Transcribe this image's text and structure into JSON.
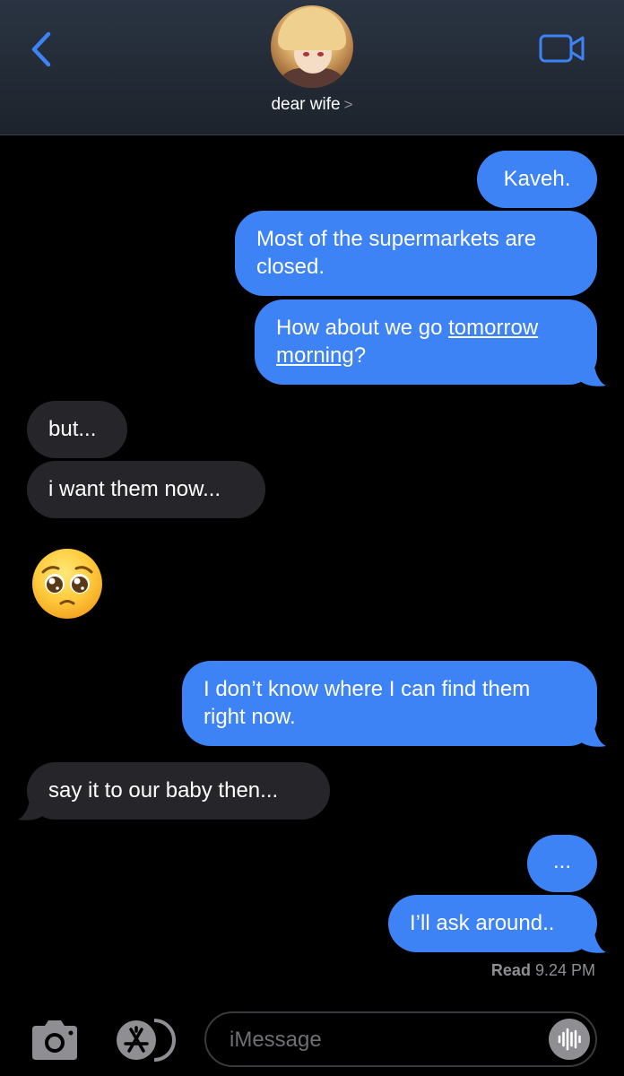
{
  "header": {
    "contact_name": "dear wife",
    "chevron": ">"
  },
  "messages": [
    {
      "from": "me",
      "text": "Kaveh."
    },
    {
      "from": "me",
      "text_lines": [
        "Most of the supermarkets are",
        "closed."
      ]
    },
    {
      "from": "me",
      "prefix": "How about we go ",
      "link_line1": "tomorrow",
      "link_line2": "morning",
      "suffix": "?"
    },
    {
      "from": "them",
      "text": "but..."
    },
    {
      "from": "them",
      "text": "i want them now..."
    },
    {
      "from": "them",
      "emoji": "pleading-face"
    },
    {
      "from": "me",
      "text_lines": [
        "I don’t know where I can find them",
        "right now."
      ]
    },
    {
      "from": "them",
      "text": "say it to our baby then..."
    },
    {
      "from": "me",
      "text": "..."
    },
    {
      "from": "me",
      "text": "I’ll ask around.."
    }
  ],
  "receipt": {
    "label": "Read",
    "time": "9.24 PM"
  },
  "composer": {
    "placeholder": "iMessage"
  },
  "colors": {
    "outgoing": "#3d83f5",
    "incoming": "#26262a",
    "accent": "#3d83f5"
  }
}
